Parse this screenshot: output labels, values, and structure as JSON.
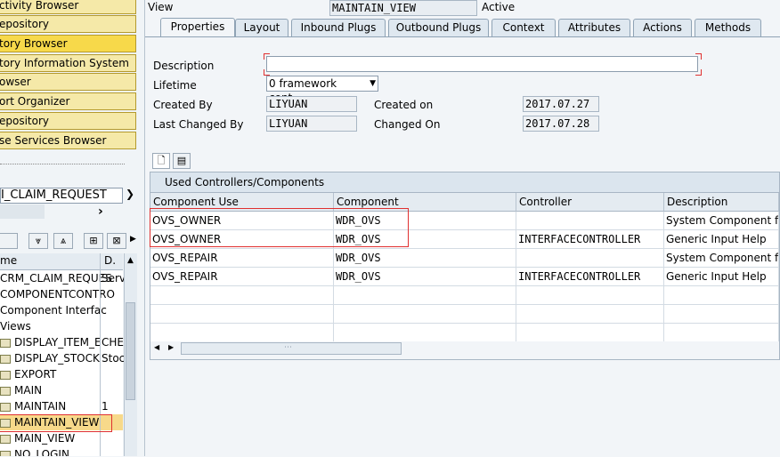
{
  "navigator": {
    "buttons": [
      {
        "label": "ctivity Browser",
        "active": false
      },
      {
        "label": "epository",
        "active": false
      },
      {
        "label": "tory Browser",
        "active": true
      },
      {
        "label": "tory Information System",
        "active": false
      },
      {
        "label": "owser",
        "active": false
      },
      {
        "label": "ort Organizer",
        "active": false
      },
      {
        "label": "epository",
        "active": false
      },
      {
        "label": "se Services Browser",
        "active": false
      }
    ],
    "object_field": "I_CLAIM_REQUEST",
    "columns": {
      "name": "me",
      "desc": "D."
    },
    "tree": [
      {
        "label": "CRM_CLAIM_REQUES",
        "desc": "Serv"
      },
      {
        "label": "COMPONENTCONTRO",
        "desc": ""
      },
      {
        "label": "Component Interfac",
        "desc": ""
      },
      {
        "label": "Views",
        "desc": ""
      },
      {
        "label": "DISPLAY_ITEM_E",
        "desc": "CHE"
      },
      {
        "label": "DISPLAY_STOCK",
        "desc": "Stoc"
      },
      {
        "label": "EXPORT",
        "desc": ""
      },
      {
        "label": "MAIN",
        "desc": ""
      },
      {
        "label": "MAINTAIN",
        "desc": "1"
      },
      {
        "label": "MAINTAIN_VIEW",
        "desc": ""
      },
      {
        "label": "MAIN_VIEW",
        "desc": ""
      },
      {
        "label": "NO_LOGIN",
        "desc": ""
      }
    ]
  },
  "header": {
    "view_label": "View",
    "view_name": "MAINTAIN_VIEW",
    "status": "Active"
  },
  "tabs": [
    {
      "label": "Properties",
      "active": true
    },
    {
      "label": "Layout",
      "active": false
    },
    {
      "label": "Inbound Plugs",
      "active": false
    },
    {
      "label": "Outbound Plugs",
      "active": false
    },
    {
      "label": "Context",
      "active": false
    },
    {
      "label": "Attributes",
      "active": false
    },
    {
      "label": "Actions",
      "active": false
    },
    {
      "label": "Methods",
      "active": false
    }
  ],
  "properties": {
    "description_label": "Description",
    "description_value": "",
    "lifetime_label": "Lifetime",
    "lifetime_value": "0 framework cont...",
    "created_by_label": "Created By",
    "created_by_value": "LIYUAN",
    "created_on_label": "Created on",
    "created_on_value": "2017.07.27",
    "changed_by_label": "Last Changed By",
    "changed_by_value": "LIYUAN",
    "changed_on_label": "Changed On",
    "changed_on_value": "2017.07.28"
  },
  "table": {
    "title": "Used Controllers/Components",
    "columns": [
      "Component Use",
      "Component",
      "Controller",
      "Description"
    ],
    "rows": [
      [
        "OVS_OWNER",
        "WDR_OVS",
        "",
        "System Component for"
      ],
      [
        "OVS_OWNER",
        "WDR_OVS",
        "INTERFACECONTROLLER",
        "Generic Input Help"
      ],
      [
        "OVS_REPAIR",
        "WDR_OVS",
        "",
        "System Component for"
      ],
      [
        "OVS_REPAIR",
        "WDR_OVS",
        "INTERFACECONTROLLER",
        "Generic Input Help"
      ]
    ]
  },
  "colors": {
    "highlight_box": "#e03030",
    "nav_button": "#f5e9a8",
    "nav_button_active": "#f7d94a"
  }
}
